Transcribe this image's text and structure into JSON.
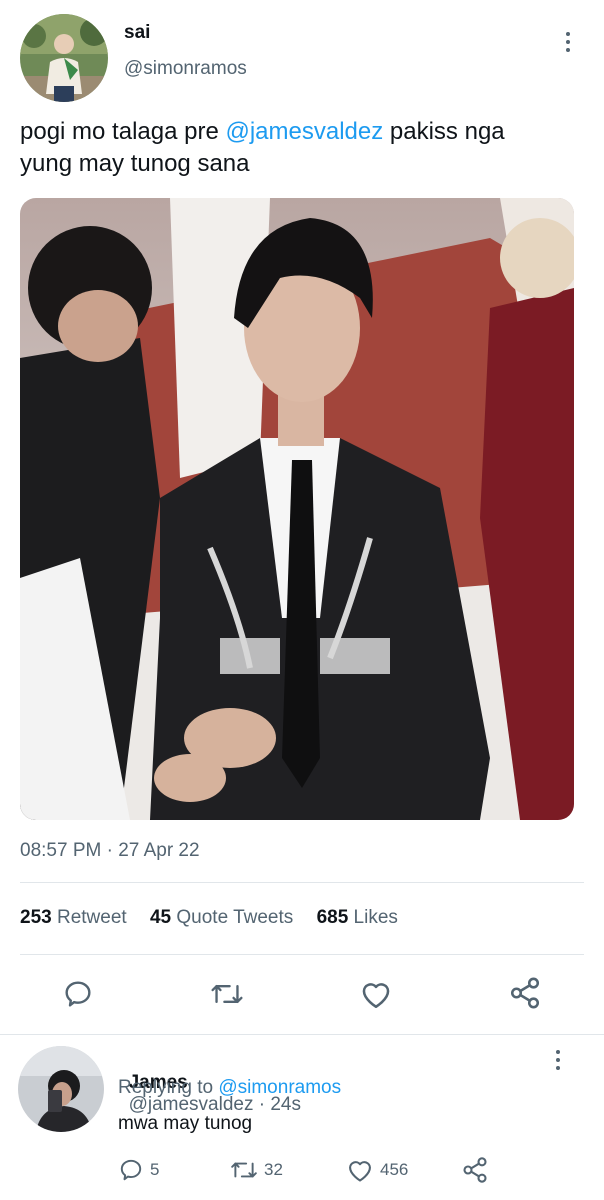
{
  "tweet": {
    "author": {
      "display_name": "sai",
      "handle": "@simonramos",
      "avatar_icon": "avatar-photo"
    },
    "text_before": "pogi mo talaga pre ",
    "mention": "@jamesvaldez",
    "text_mid": " pakiss nga",
    "text_line2": "yung may tunog sana",
    "media_icon": "photo",
    "time": "08:57 PM",
    "date_sep": " · ",
    "date": "27 Apr 22",
    "stats": {
      "retweets": "253",
      "retweets_label": "Retweet",
      "quotes": "45",
      "quotes_label": "Quote Tweets",
      "likes": "685",
      "likes_label": "Likes"
    },
    "actions": [
      "reply-icon",
      "retweet-icon",
      "like-icon",
      "share-icon"
    ]
  },
  "reply": {
    "author": {
      "display_name": "James",
      "handle": "@jamesvaldez",
      "sep": " · ",
      "time": "24s"
    },
    "replying_prefix": "Replying to ",
    "replying_to": "@simonramos",
    "text": "mwa may tunog",
    "counts": {
      "replies": "5",
      "retweets": "32",
      "likes": "456"
    }
  },
  "colors": {
    "accent": "#1d9bf0",
    "text": "#0f1419",
    "muted": "#536471",
    "divider": "#e1e6ea"
  }
}
